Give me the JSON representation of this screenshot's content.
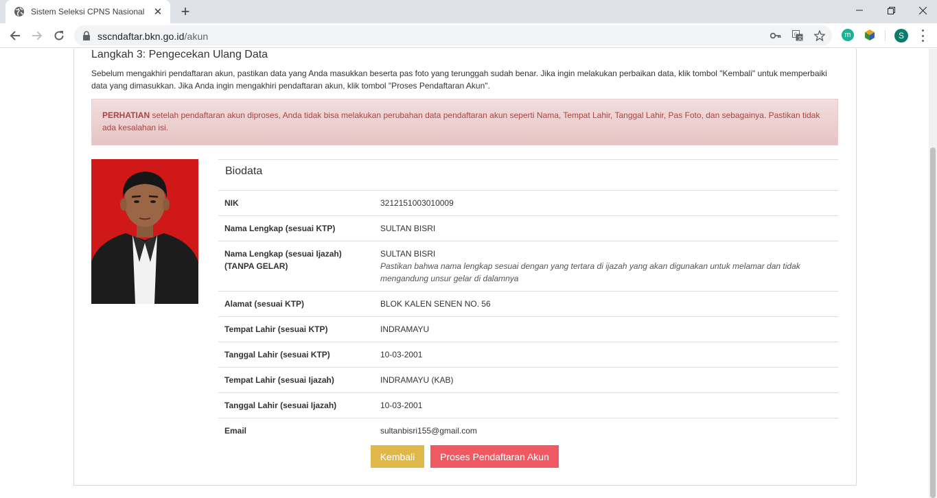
{
  "browser": {
    "tab_title": "Sistem Seleksi CPNS Nasional",
    "url_host": "sscndaftar.bkn.go.id",
    "url_path": "/akun",
    "profile_initial": "S",
    "extension_m": "m"
  },
  "page": {
    "step_title": "Langkah 3: Pengecekan Ulang Data",
    "intro": "Sebelum mengakhiri pendaftaran akun, pastikan data yang Anda masukkan beserta pas foto yang terunggah sudah benar. Jika ingin melakukan perbaikan data, klik tombol \"Kembali\" untuk memperbaiki data yang dimasukkan. Jika Anda ingin mengakhiri pendaftaran akun, klik tombol \"Proses Pendaftaran Akun\".",
    "alert_strong": "PERHATIAN",
    "alert_text": " setelah pendaftaran akun diproses, Anda tidak bisa melakukan perubahan data pendaftaran akun seperti Nama, Tempat Lahir, Tanggal Lahir, Pas Foto, dan sebagainya. Pastikan tidak ada kesalahan isi.",
    "biodata_title": "Biodata",
    "rows": [
      {
        "label": "NIK",
        "value": "3212151003010009"
      },
      {
        "label": "Nama Lengkap (sesuai KTP)",
        "value": "SULTAN BISRI"
      },
      {
        "label": "Nama Lengkap (sesuai Ijazah) (TANPA GELAR)",
        "value": "SULTAN BISRI",
        "note": "Pastikan bahwa nama lengkap sesuai dengan yang tertara di ijazah yang akan digunakan untuk melamar dan tidak mengandung unsur gelar di dalamnya"
      },
      {
        "label": "Alamat (sesuai KTP)",
        "value": "BLOK KALEN SENEN NO. 56"
      },
      {
        "label": "Tempat Lahir (sesuai KTP)",
        "value": "INDRAMAYU"
      },
      {
        "label": "Tanggal Lahir (sesuai KTP)",
        "value": "10-03-2001"
      },
      {
        "label": "Tempat Lahir (sesuai Ijazah)",
        "value": "INDRAMAYU (KAB)"
      },
      {
        "label": "Tanggal Lahir (sesuai Ijazah)",
        "value": "10-03-2001"
      },
      {
        "label": "Email",
        "value": "sultanbisri155@gmail.com"
      }
    ],
    "buttons": {
      "back": "Kembali",
      "process": "Proses Pendaftaran Akun"
    }
  },
  "colors": {
    "btn_back": "#e0b84a",
    "btn_process": "#ef5a62",
    "alert_text": "#a94442",
    "photo_bg": "#d21a1a"
  }
}
